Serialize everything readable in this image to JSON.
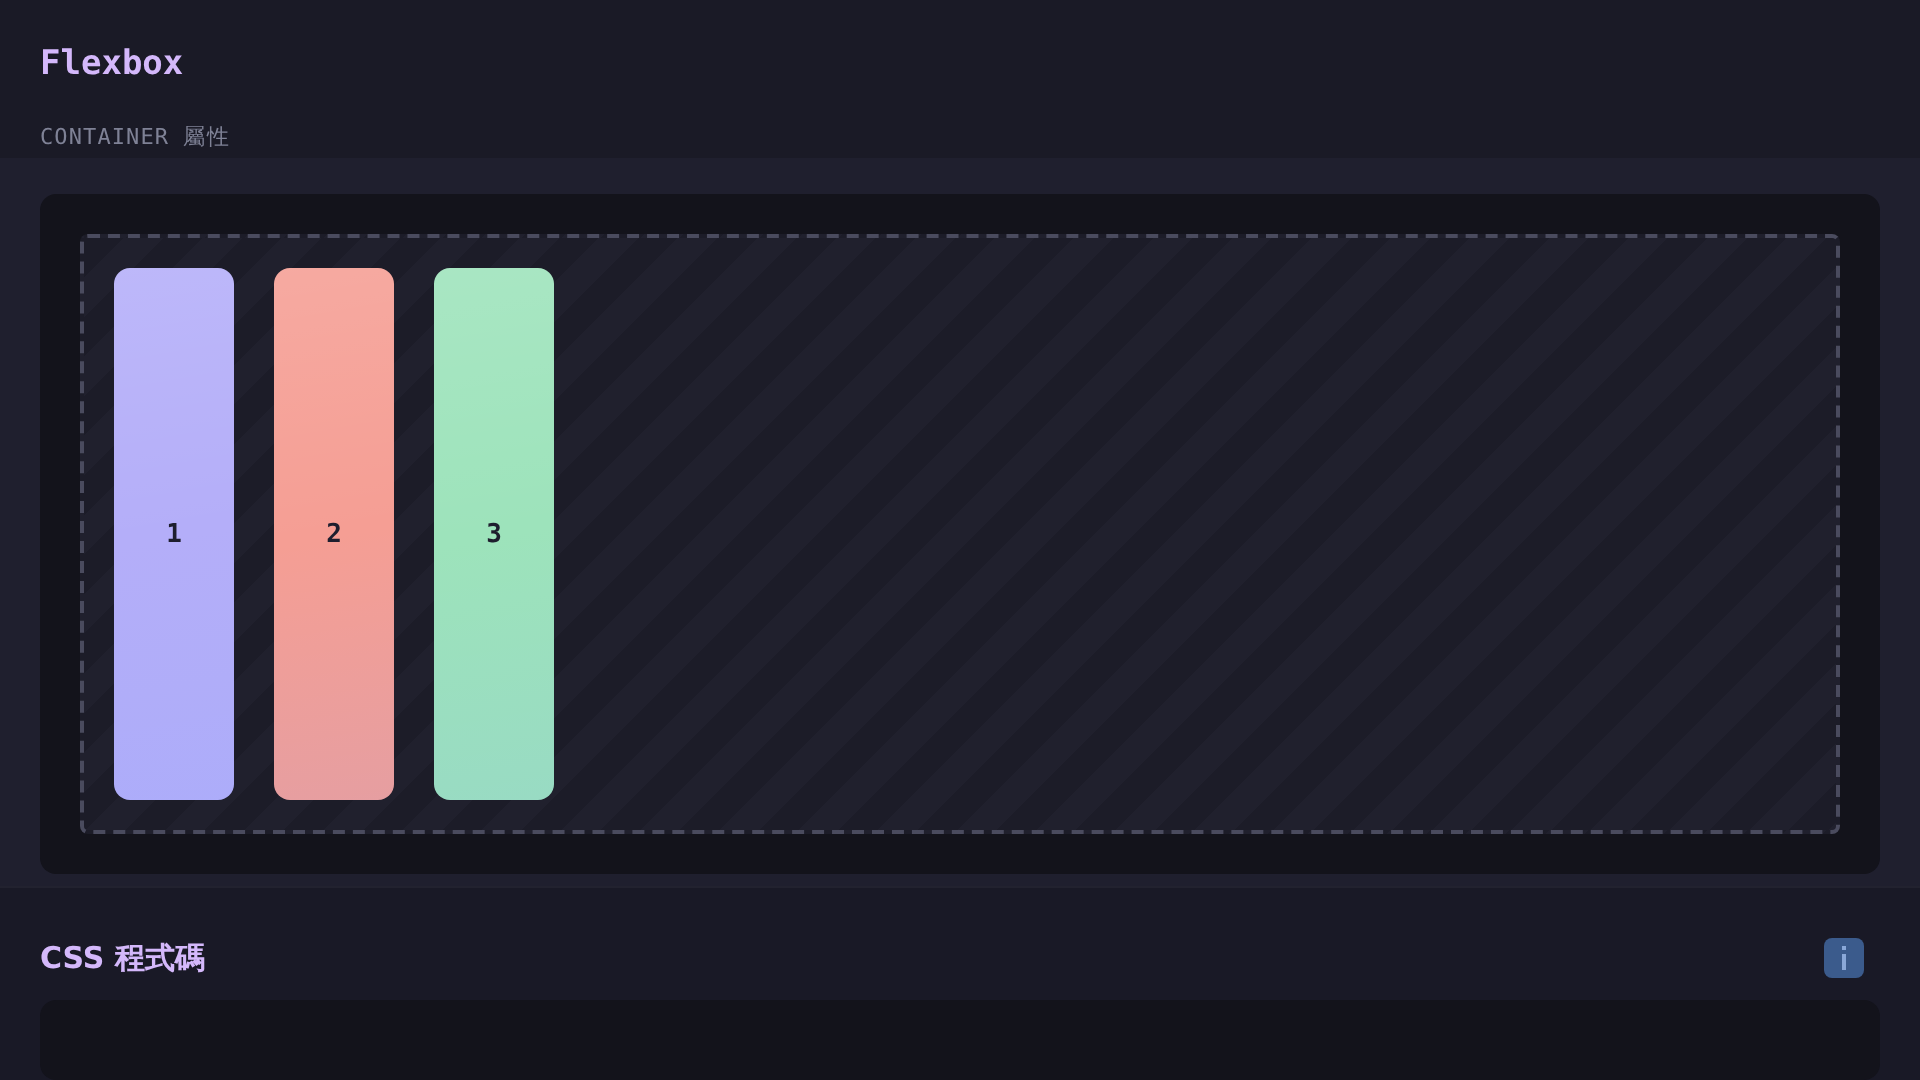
{
  "title": "Flexbox",
  "section_label": "CONTAINER 屬性",
  "items": [
    {
      "label": "1",
      "color": "#b4aef9"
    },
    {
      "label": "2",
      "color": "#f59e94"
    },
    {
      "label": "3",
      "color": "#9de3bb"
    }
  ],
  "code_section": {
    "title": "CSS 程式碼"
  }
}
